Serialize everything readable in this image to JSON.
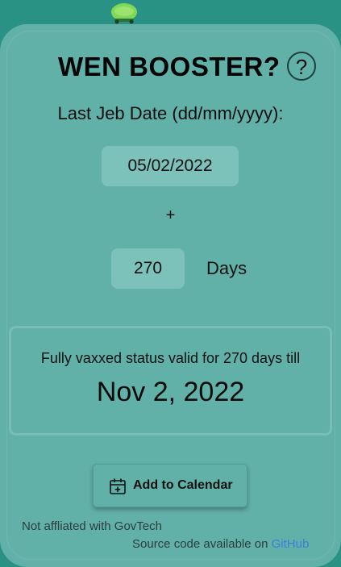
{
  "header": {
    "title": "WEN BOOSTER?",
    "help_glyph": "?"
  },
  "form": {
    "date_label": "Last Jeb Date (dd/mm/yyyy):",
    "date_value": "05/02/2022",
    "plus": "+",
    "days_value": "270",
    "days_label": "Days"
  },
  "result": {
    "text": "Fully vaxxed status valid for 270 days till",
    "date": "Nov 2, 2022"
  },
  "actions": {
    "calendar_label": "Add to Calendar",
    "calendar_icon": "calendar-add-icon"
  },
  "footer": {
    "disclaimer": "Not affliated with GovTech",
    "source_prefix": "Source code available on ",
    "source_link": "GitHub"
  },
  "colors": {
    "background": "#2a9284",
    "card": "#62b1a9",
    "input_bg": "#7cc1ba",
    "link": "#3b7fd8",
    "mascot": "#7ed957"
  }
}
